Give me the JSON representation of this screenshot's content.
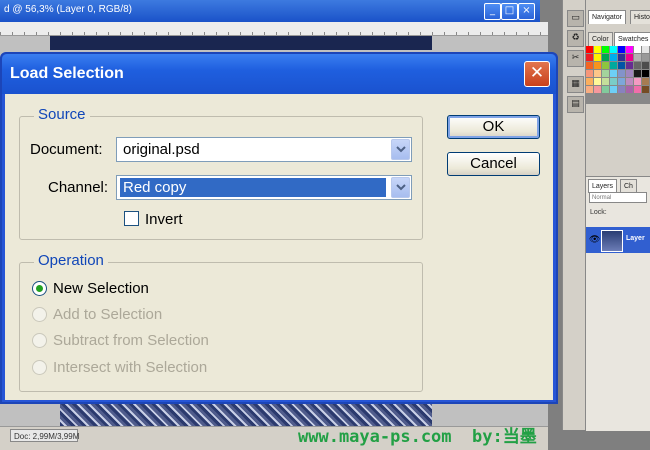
{
  "photoshop": {
    "doc_title": "d @ 56,3% (Layer 0, RGB/8)",
    "doc_status": "Doc: 2,99M/3,99M",
    "window_buttons": [
      "_",
      "□",
      "×"
    ],
    "panels": {
      "tabs_top": [
        "Navigator",
        "Histo"
      ],
      "tabs_mid": [
        "Color",
        "Swatches"
      ],
      "tabs_layers": [
        "Layers",
        "Ch"
      ],
      "blend_mode": "Normal",
      "lock_label": "Lock:",
      "layer_name": "Layer"
    },
    "swatch_colors": [
      "#ff0000",
      "#ffff00",
      "#00ff00",
      "#00ffff",
      "#0000ff",
      "#ff00ff",
      "#ffffff",
      "#e6e6e6",
      "#cccccc",
      "#ed1c24",
      "#fff200",
      "#00a651",
      "#00aeef",
      "#2e3192",
      "#ec008c",
      "#b3b3b3",
      "#999999",
      "#808080",
      "#f26522",
      "#f7941d",
      "#8dc63f",
      "#00a99d",
      "#0054a6",
      "#662d91",
      "#666666",
      "#4d4d4d",
      "#333333",
      "#f69679",
      "#fdc689",
      "#a3d39c",
      "#6dcff6",
      "#8393ca",
      "#a186be",
      "#1a1a1a",
      "#000000",
      "#c69c6d",
      "#fbaf5d",
      "#fff799",
      "#c4df9b",
      "#7accc8",
      "#7da7d9",
      "#bd8cbf",
      "#f49ac2",
      "#a67c52",
      "#8c6239",
      "#f9ad81",
      "#f5989d",
      "#82ca9c",
      "#6ecff6",
      "#8882be",
      "#a864a8",
      "#f06eaa",
      "#754c24",
      "#603913"
    ],
    "watermark": "www.maya-ps.com  by:当墨"
  },
  "dialog": {
    "title": "Load Selection",
    "close_glyph": "✕",
    "source": {
      "legend": "Source",
      "document_label": "Document:",
      "document_value": "original.psd",
      "channel_label": "Channel:",
      "channel_value": "Red copy",
      "invert_label": "Invert",
      "invert_checked": false
    },
    "operation": {
      "legend": "Operation",
      "options": [
        {
          "label": "New Selection",
          "selected": true,
          "enabled": true
        },
        {
          "label": "Add to Selection",
          "selected": false,
          "enabled": false
        },
        {
          "label": "Subtract from Selection",
          "selected": false,
          "enabled": false
        },
        {
          "label": "Intersect with Selection",
          "selected": false,
          "enabled": false
        }
      ]
    },
    "ok_label": "OK",
    "cancel_label": "Cancel"
  }
}
